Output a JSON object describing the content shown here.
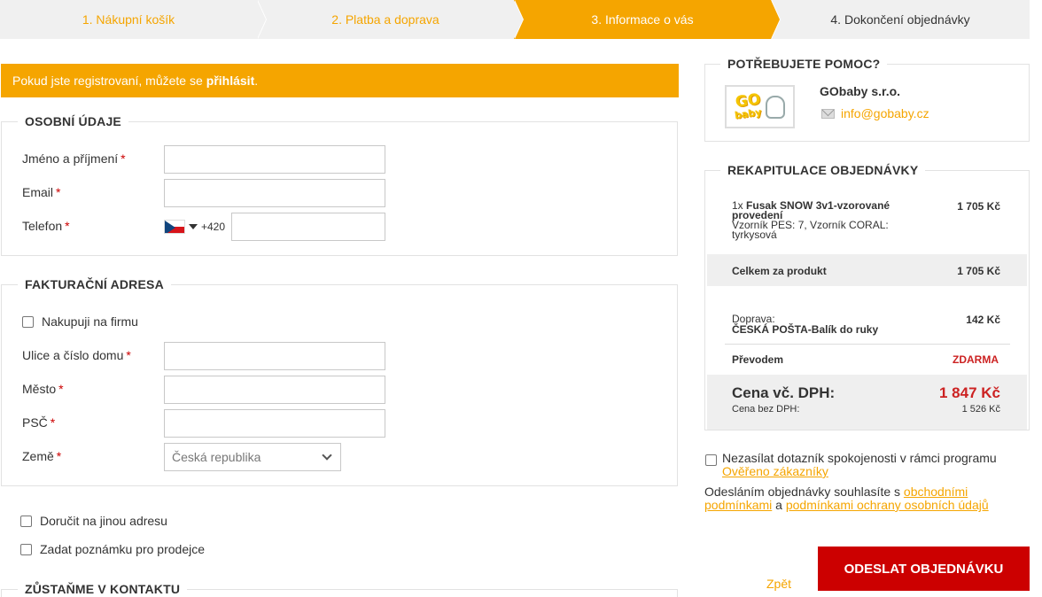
{
  "steps": [
    {
      "label": "1. Nákupní košík"
    },
    {
      "label": "2. Platba a doprava"
    },
    {
      "label": "3. Informace o vás"
    },
    {
      "label": "4. Dokončení objednávky"
    }
  ],
  "login_banner": {
    "text": "Pokud jste registrovaní, můžete se",
    "link": "přihlásit",
    "suffix": "."
  },
  "personal": {
    "title": "OSOBNÍ ÚDAJE",
    "name_label": "Jméno a příjmení",
    "email_label": "Email",
    "phone_label": "Telefon",
    "phone_prefix": "+420",
    "required_mark": "*",
    "name_value": "",
    "email_value": "",
    "phone_value": ""
  },
  "billing": {
    "title": "FAKTURAČNÍ ADRESA",
    "company_checkbox": "Nakupuji na firmu",
    "street_label": "Ulice a číslo domu",
    "city_label": "Město",
    "zip_label": "PSČ",
    "country_label": "Země",
    "country_selected": "Česká republika"
  },
  "options": {
    "other_address": "Doručit na jinou adresu",
    "seller_note": "Zadat poznámku pro prodejce"
  },
  "contact": {
    "title": "ZŮSTAŇME V KONTAKTU"
  },
  "help": {
    "title": "POTŘEBUJETE POMOC?",
    "company": "GObaby s.r.o.",
    "email": "info@gobaby.cz",
    "logo_go": "GO",
    "logo_baby": "baby"
  },
  "recap": {
    "title": "REKAPITULACE OBJEDNÁVKY",
    "item_qty": "1x",
    "item_name": "Fusak SNOW 3v1-vzorované provedení",
    "item_variant": "Vzorník PES: 7, Vzorník CORAL: tyrkysová",
    "item_price": "1 705 Kč",
    "product_total_label": "Celkem za produkt",
    "product_total_value": "1 705 Kč",
    "shipping_label": "Doprava:",
    "shipping_name": "ČESKÁ POŠTA-Balík do ruky",
    "shipping_price": "142 Kč",
    "payment_label": "Převodem",
    "payment_price": "ZDARMA",
    "total_label": "Cena vč. DPH:",
    "total_value": "1 847 Kč",
    "net_label": "Cena bez DPH:",
    "net_value": "1 526 Kč"
  },
  "survey": {
    "text": "Nezasílat dotazník spokojenosti v rámci programu",
    "link": "Ověřeno zákazníky"
  },
  "terms": {
    "prefix": "Odesláním objednávky souhlasíte s",
    "link1": "obchodními podmínkami",
    "middle": "a",
    "link2": "podmínkami ochrany osobních údajů"
  },
  "actions": {
    "back": "Zpět",
    "submit": "ODESLAT OBJEDNÁVKU"
  },
  "colors": {
    "accent": "#f5a500",
    "danger": "#cc0000",
    "price_red": "#cc2222"
  }
}
